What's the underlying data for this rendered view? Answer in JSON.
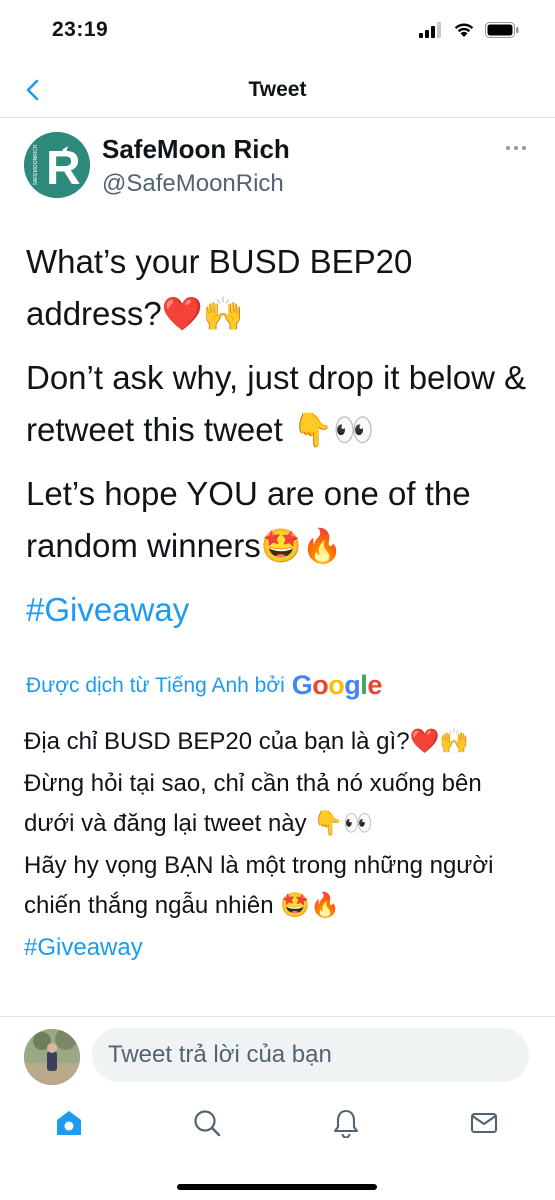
{
  "status_bar": {
    "time": "23:19"
  },
  "nav": {
    "title": "Tweet"
  },
  "author": {
    "name": "SafeMoon Rich",
    "handle": "@SafeMoonRich",
    "avatar_letter": "R",
    "avatar_text": "SAFEMOONRICH"
  },
  "tweet": {
    "paragraphs": [
      "What’s your BUSD BEP20 address?❤️🙌",
      "Don’t ask why, just drop it below & retweet this tweet 👇👀",
      "Let’s hope YOU are one of the random winners🤩🔥"
    ],
    "hashtag": "#Giveaway"
  },
  "translation": {
    "credit": "Được dịch từ Tiếng Anh bởi",
    "provider": "Google",
    "paragraphs": [
      "Địa chỉ BUSD BEP20 của bạn là gì?❤️🙌",
      " Đừng hỏi tại sao, chỉ cần thả nó xuống bên dưới và đăng lại tweet này  👇👀",
      " Hãy hy vọng BẠN là một trong những người chiến thắng ngẫu nhiên 🤩🔥"
    ],
    "hashtag": "#Giveaway"
  },
  "reply": {
    "placeholder": "Tweet trả lời của bạn"
  },
  "tab_bar": {
    "icons": [
      "home-icon",
      "search-icon",
      "notifications-icon",
      "messages-icon"
    ]
  },
  "colors": {
    "accent": "#1d9bf0",
    "text": "#0f1419",
    "secondary": "#536471",
    "avatar_bg": "#2f8a7e"
  }
}
